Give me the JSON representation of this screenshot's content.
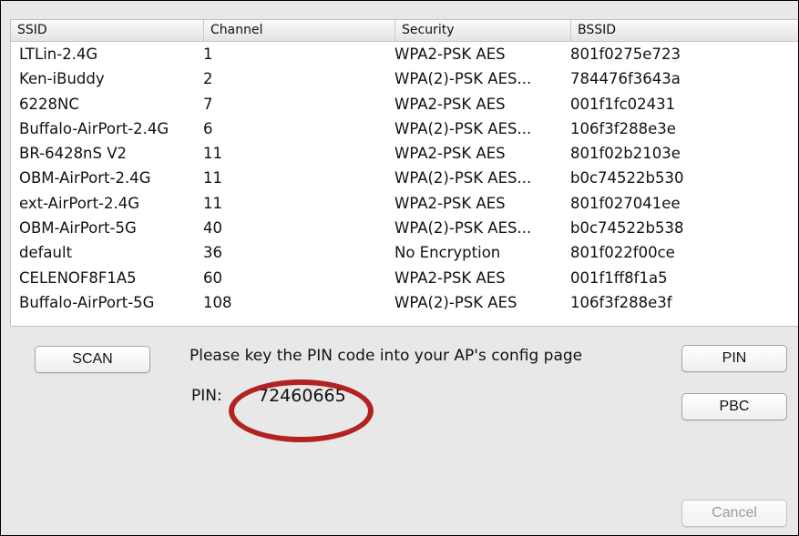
{
  "table": {
    "columns": [
      "SSID",
      "Channel",
      "Security",
      "BSSID"
    ],
    "rows": [
      [
        "LTLin-2.4G",
        "1",
        "WPA2-PSK AES",
        "801f0275e723"
      ],
      [
        "Ken-iBuddy",
        "2",
        "WPA(2)-PSK AES...",
        "784476f3643a"
      ],
      [
        "6228NC",
        "7",
        "WPA2-PSK AES",
        "001f1fc02431"
      ],
      [
        "Buffalo-AirPort-2.4G",
        "6",
        "WPA(2)-PSK AES...",
        "106f3f288e3e"
      ],
      [
        "BR-6428nS V2",
        "11",
        "WPA2-PSK AES",
        "801f02b2103e"
      ],
      [
        "OBM-AirPort-2.4G",
        "11",
        "WPA(2)-PSK AES...",
        "b0c74522b530"
      ],
      [
        "ext-AirPort-2.4G",
        "11",
        "WPA2-PSK AES",
        "801f027041ee"
      ],
      [
        "OBM-AirPort-5G",
        "40",
        "WPA(2)-PSK AES...",
        "b0c74522b538"
      ],
      [
        "default",
        "36",
        "No Encryption",
        "801f022f00ce"
      ],
      [
        "CELENOF8F1A5",
        "60",
        "WPA2-PSK AES",
        "001f1ff8f1a5"
      ],
      [
        "Buffalo-AirPort-5G",
        "108",
        "WPA(2)-PSK AES",
        "106f3f288e3f"
      ]
    ]
  },
  "buttons": {
    "scan": "SCAN",
    "pin": "PIN",
    "pbc": "PBC",
    "cancel": "Cancel"
  },
  "instruction": "Please key the PIN code into your AP's config page",
  "pin": {
    "label": "PIN:",
    "value": "72460665"
  },
  "colors": {
    "highlight_ellipse": "#b22222",
    "table_border": "#b5c4d4"
  }
}
